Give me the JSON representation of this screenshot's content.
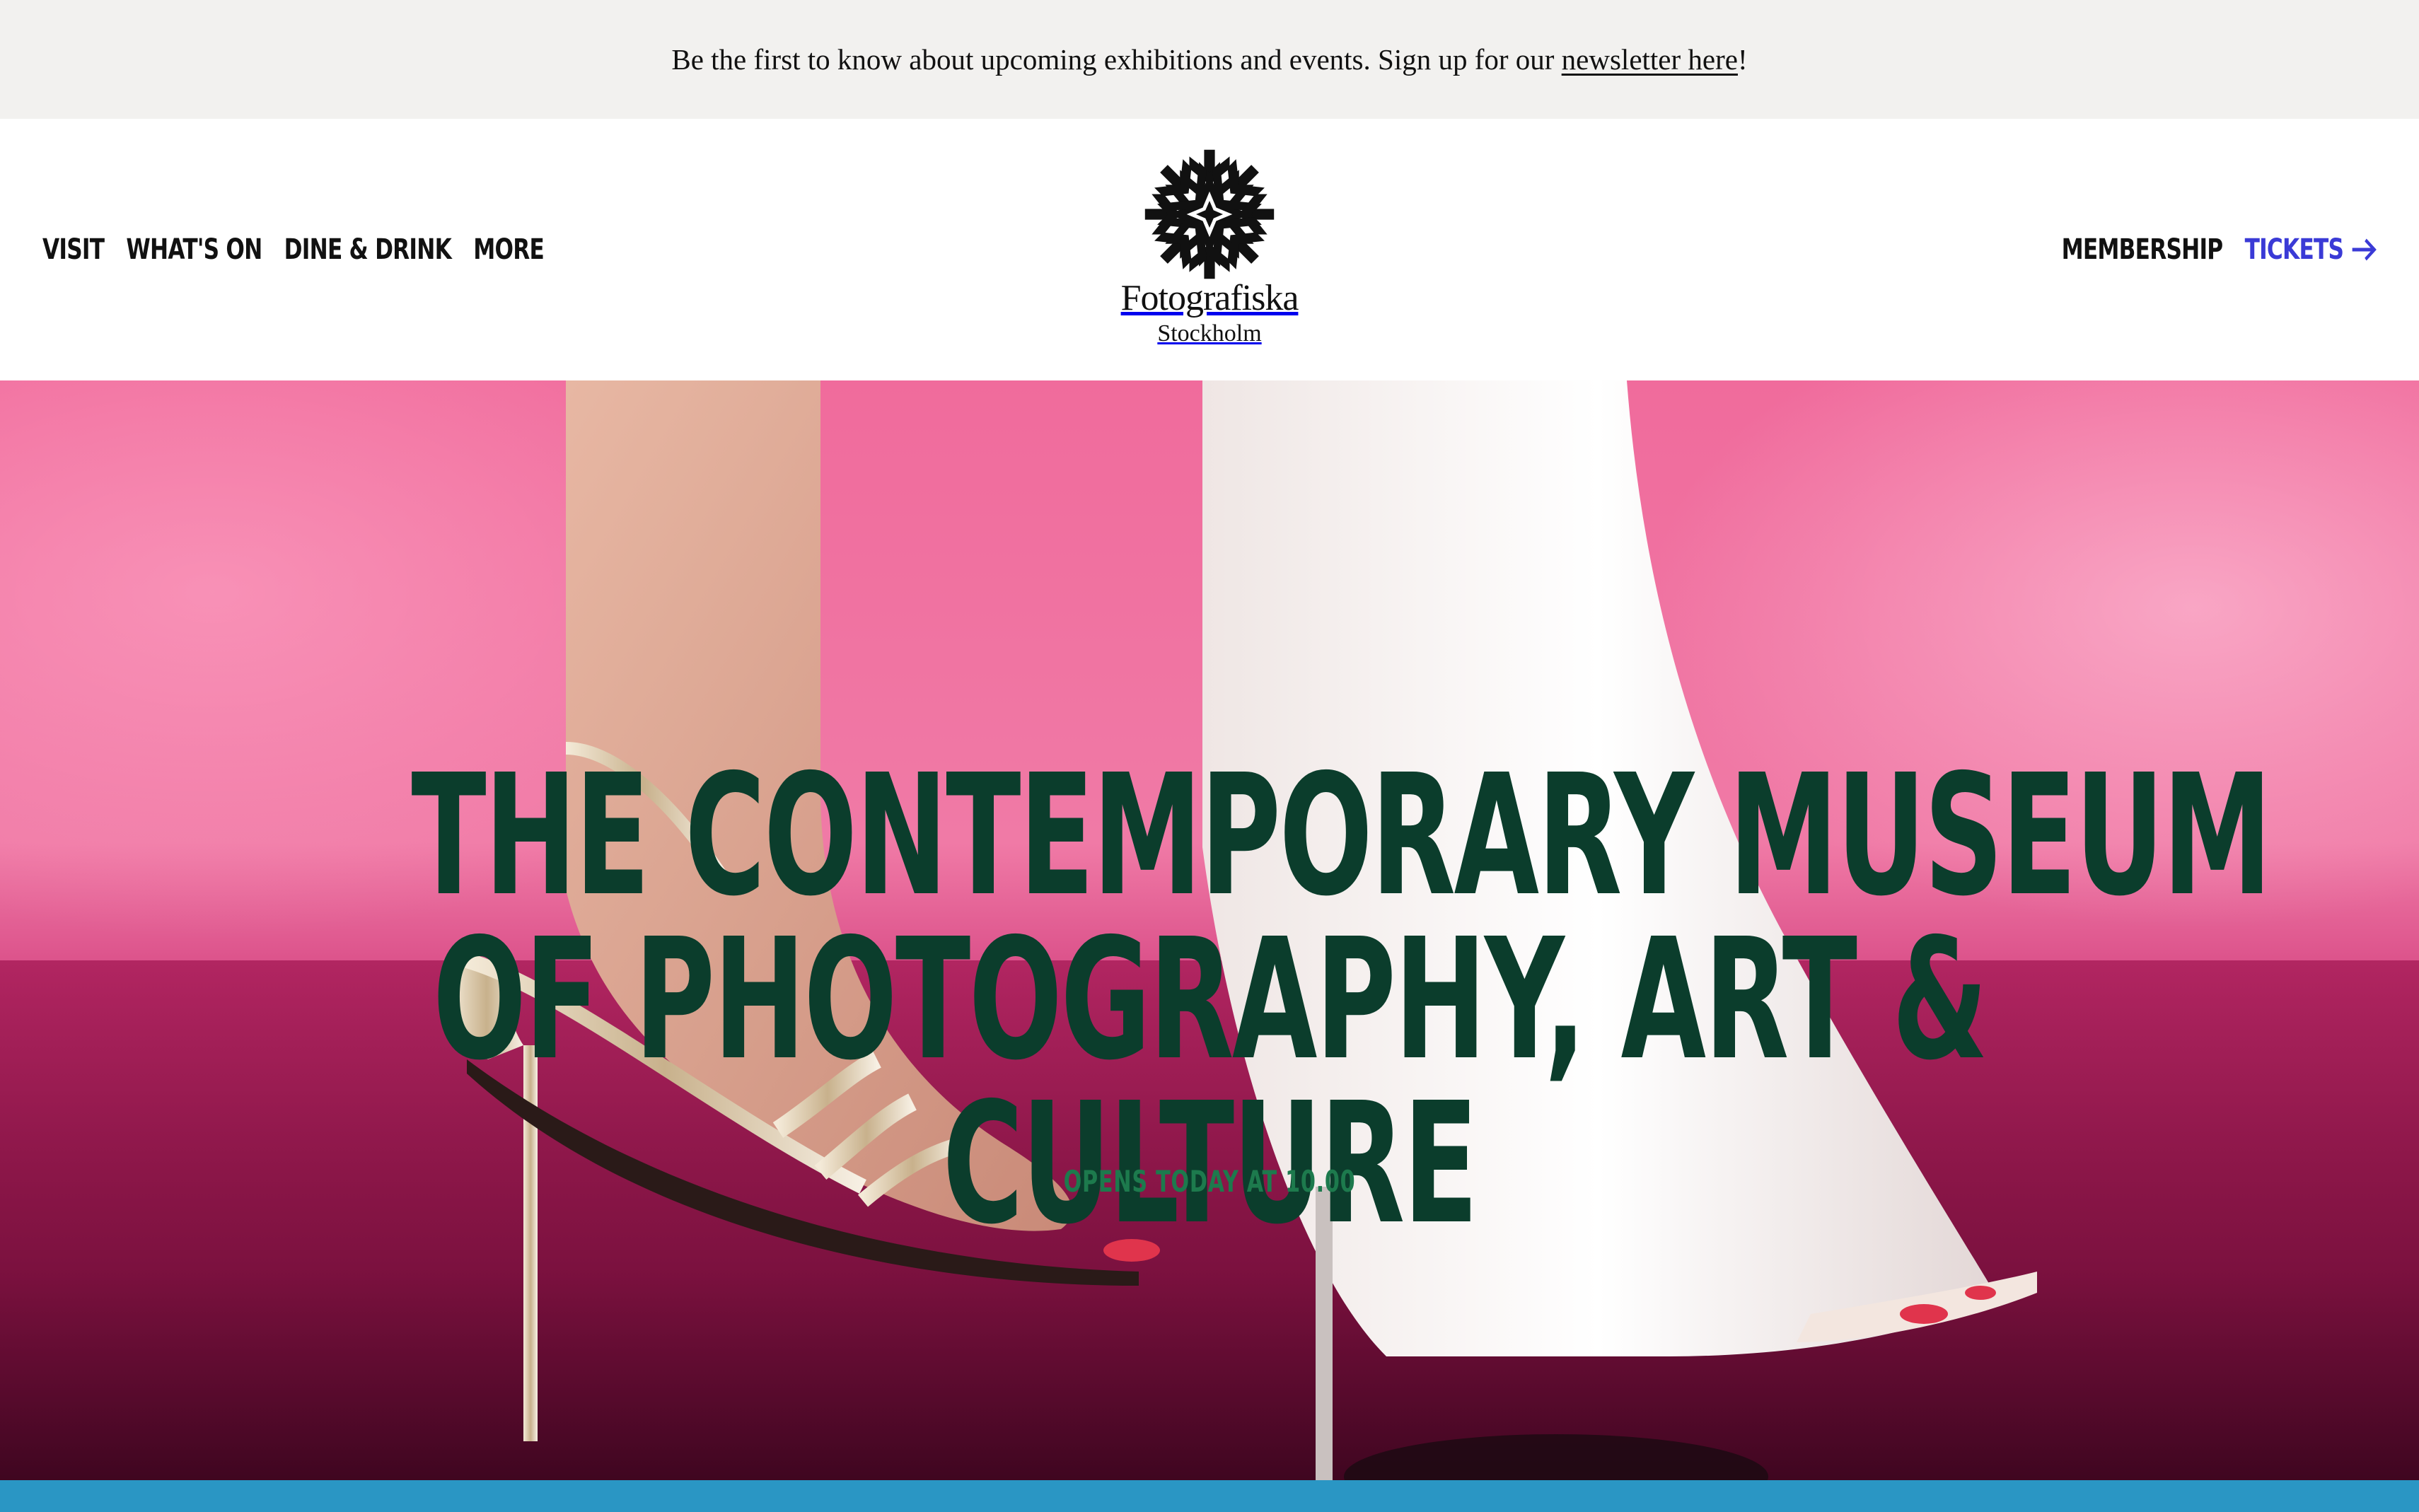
{
  "announcement": {
    "text": "Be the first to know about upcoming exhibitions and events. Sign up for our ",
    "link_label": "newsletter here",
    "suffix": "!"
  },
  "nav_left": [
    {
      "label": "VISIT"
    },
    {
      "label": "WHAT'S ON"
    },
    {
      "label": "DINE & DRINK"
    },
    {
      "label": "MORE"
    }
  ],
  "nav_right": {
    "membership": "MEMBERSHIP",
    "tickets": "TICKETS"
  },
  "logo": {
    "name": "Fotografiska",
    "city": "Stockholm"
  },
  "hero": {
    "headline_lines": [
      "THE CONTEMPORARY MUSEUM",
      "OF PHOTOGRAPHY, ART &",
      "CULTURE"
    ],
    "subline": "OPENS TODAY AT 10.00"
  },
  "colors": {
    "announcement_bg": "#f2f1ef",
    "tickets_accent": "#3a3ad6",
    "headline": "#0b3d2c",
    "subline": "#1d7a4d",
    "bottom_bar": "#2a96c4"
  },
  "icons": {
    "logo_mark": "snowflake-star-logo-icon",
    "tickets_arrow": "arrow-right-icon"
  }
}
